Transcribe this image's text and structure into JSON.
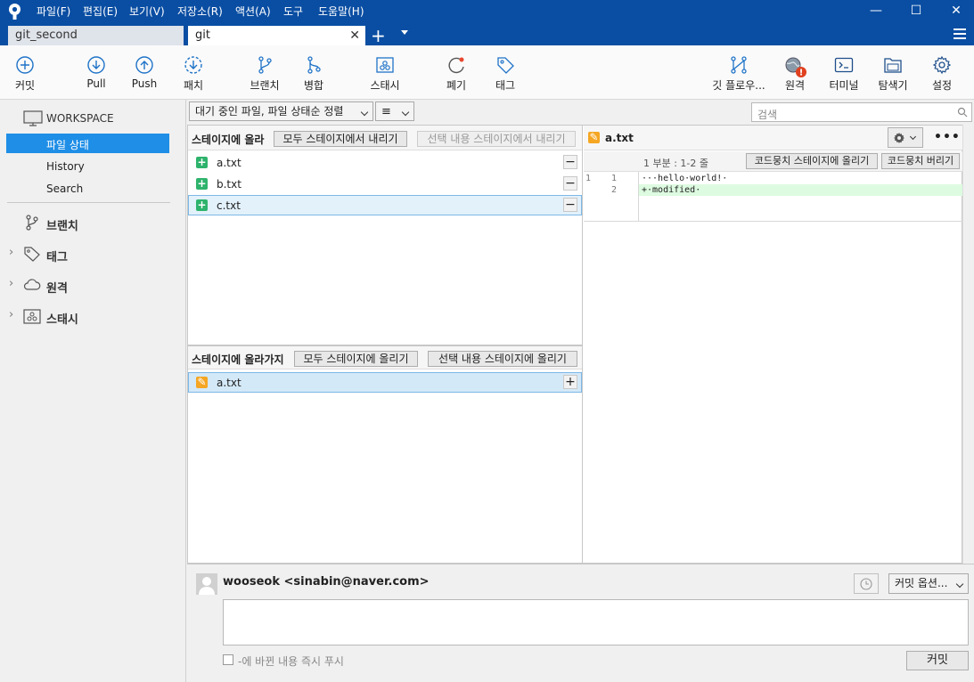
{
  "menu": [
    "파일(F)",
    "편집(E)",
    "보기(V)",
    "저장소(R)",
    "액션(A)",
    "도구",
    "도움말(H)"
  ],
  "window": {
    "minimize": "—",
    "maximize": "☐",
    "close": "✕"
  },
  "tabs": [
    {
      "label": "git_second"
    },
    {
      "label": "git"
    }
  ],
  "tab_close": "✕",
  "tab_add": "+",
  "toolbar": {
    "commit": "커밋",
    "pull": "Pull",
    "push": "Push",
    "fetch": "패치",
    "branch": "브랜치",
    "merge": "병합",
    "stash": "스태시",
    "discard": "폐기",
    "tag": "태그",
    "gitflow": "깃 플로우...",
    "remote": "원격",
    "terminal": "터미널",
    "explorer": "탐색기",
    "settings": "설정"
  },
  "sidebar": {
    "workspace": "WORKSPACE",
    "items": [
      "파일 상태",
      "History",
      "Search"
    ],
    "sections": [
      "브랜치",
      "태그",
      "원격",
      "스태시"
    ]
  },
  "filter": {
    "sort_label": "대기 중인 파일, 파일 상태순 정렬",
    "search_placeholder": "검색"
  },
  "staged": {
    "title": "스테이지에 올라",
    "unstage_all": "모두 스테이지에서 내리기",
    "unstage_selected": "선택 내용 스테이지에서 내리기",
    "files": [
      "a.txt",
      "b.txt",
      "c.txt"
    ]
  },
  "unstaged": {
    "title": "스테이지에 올라가지",
    "stage_all": "모두 스테이지에 올리기",
    "stage_selected": "선택 내용 스테이지에 올리기",
    "files": [
      "a.txt"
    ]
  },
  "diff": {
    "filename": "a.txt",
    "hunk_header": "1 부분 : 1-2 줄",
    "stage_hunk": "코드뭉치 스테이지에 올리기",
    "discard_hunk": "코드뭉치 버리기",
    "lines": [
      {
        "old": "1",
        "new": "1",
        "text": "···hello·world!·"
      },
      {
        "old": "",
        "new": "2",
        "text": "+·modified·"
      }
    ]
  },
  "commit": {
    "author": "wooseok <sinabin@naver.com>",
    "options": "커밋 옵션...",
    "push_checkbox": "-에 바뀐 내용 즉시 푸시",
    "commit_button": "커밋"
  },
  "colors": {
    "brand": "#0a4ea3",
    "selection": "#1f8ee6",
    "added": "#2eb36c",
    "modified": "#f5a623"
  }
}
